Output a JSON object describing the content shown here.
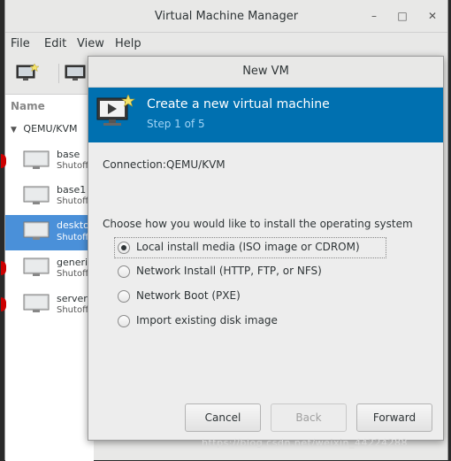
{
  "main_window": {
    "title": "Virtual Machine Manager",
    "controls": {
      "minimize": "–",
      "maximize": "□",
      "close": "✕"
    },
    "menu": [
      "File",
      "Edit",
      "View",
      "Help"
    ],
    "list": {
      "column": "Name",
      "group": "QEMU/KVM",
      "vms": [
        {
          "name": "base",
          "status": "Shutoff"
        },
        {
          "name": "base1",
          "status": "Shutoff"
        },
        {
          "name": "desktop",
          "status": "Shutoff"
        },
        {
          "name": "generic",
          "status": "Shutoff"
        },
        {
          "name": "server",
          "status": "Shutoff"
        }
      ]
    }
  },
  "dialog": {
    "title": "New VM",
    "banner": {
      "title": "Create a new virtual machine",
      "step": "Step 1 of 5"
    },
    "connection_label": "Connection:",
    "connection_value": "QEMU/KVM",
    "prompt": "Choose how you would like to install the operating system",
    "options": [
      {
        "label": "Local install media (ISO image or CDROM)",
        "selected": true
      },
      {
        "label": "Network Install (HTTP, FTP, or NFS)",
        "selected": false
      },
      {
        "label": "Network Boot (PXE)",
        "selected": false
      },
      {
        "label": "Import existing disk image",
        "selected": false
      }
    ],
    "buttons": {
      "cancel": "Cancel",
      "back": "Back",
      "forward": "Forward"
    }
  },
  "watermark": "https://blog.csdn.net/weixin_44224288",
  "colors": {
    "banner": "#0070b0",
    "selection": "#4a90d9",
    "step_text": "#9fd3f5"
  }
}
